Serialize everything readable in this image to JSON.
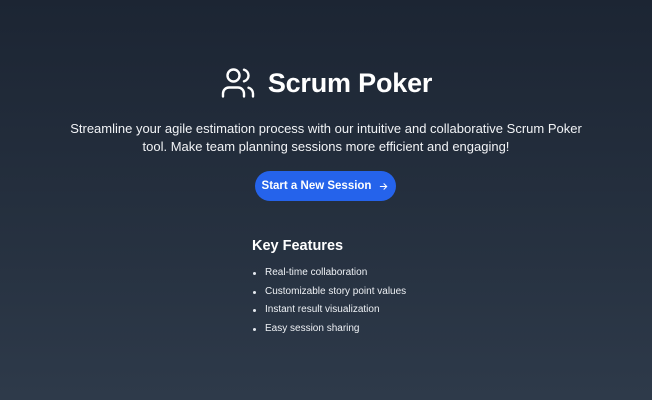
{
  "header": {
    "title": "Scrum Poker",
    "icon": "users-icon"
  },
  "hero": {
    "tagline": "Streamline your agile estimation process with our intuitive and collaborative Scrum Poker tool. Make team planning sessions more efficient and engaging!",
    "cta_label": "Start a New Session",
    "cta_icon": "arrow-right-icon"
  },
  "features": {
    "heading": "Key Features",
    "items": [
      "Real-time collaboration",
      "Customizable story point values",
      "Instant result visualization",
      "Easy session sharing"
    ]
  },
  "colors": {
    "background_top": "#1c2533",
    "background_bottom": "#2e3a4a",
    "accent": "#2563eb",
    "text": "#ffffff"
  }
}
